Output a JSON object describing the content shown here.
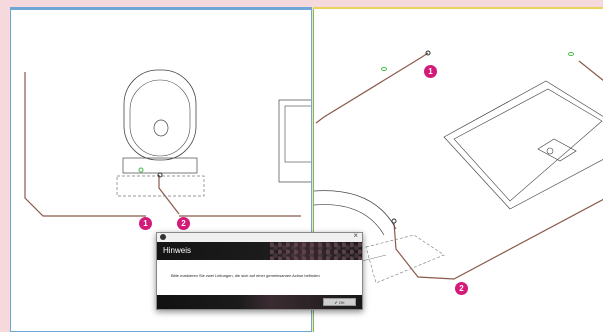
{
  "dialog": {
    "title": "Hinweis",
    "message": "Bitte markieren Sie zwei Leitungen, die sich auf einer gemeinsamen Achse befinden",
    "ok_label": "OK",
    "ok_icon": "✔",
    "close_icon": "×"
  },
  "callouts": {
    "left": [
      "1",
      "2"
    ],
    "right": [
      "1",
      "2"
    ]
  },
  "colors": {
    "background": "#f6d9dc",
    "left_viewport_border": "#6ea6d6",
    "right_viewport_border": "#7fbf3f",
    "right_viewport_top": "#e8d45a",
    "leader_line": "#8a5a4a",
    "badge": "#d31a79",
    "marker": "#44bb44"
  }
}
